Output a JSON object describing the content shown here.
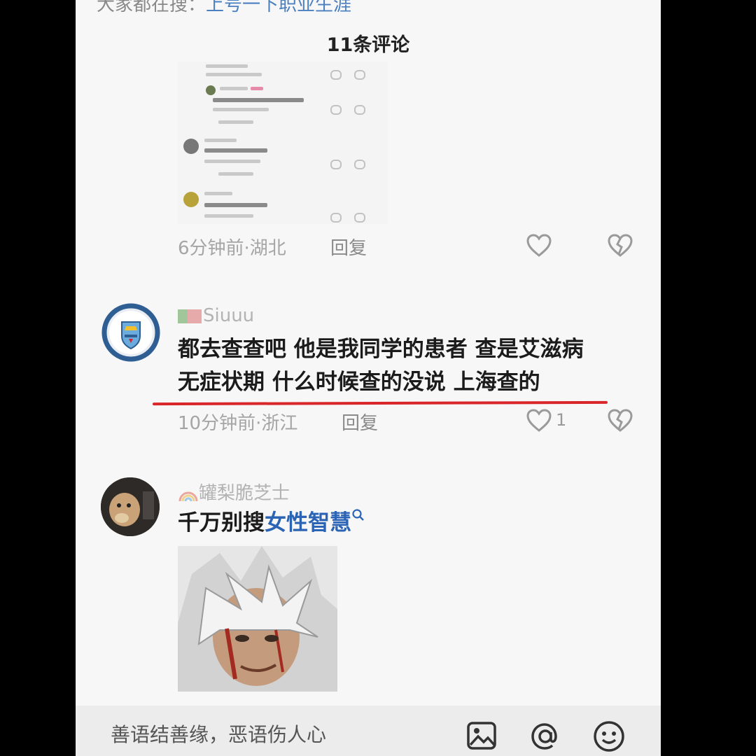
{
  "header": {
    "cut_text": "大家都在搜：",
    "cut_text_blue": "上号一下职业生涯",
    "title": "11条评论"
  },
  "comments": [
    {
      "meta": "6分钟前·湖北",
      "reply": "回复",
      "like_count": ""
    },
    {
      "name": "Siuuu",
      "text_lines": [
        "都去查查吧 他是我同学的患者 查是艾滋病",
        "无症状期 什么时候查的没说 上海查的"
      ],
      "meta": "10分钟前·浙江",
      "reply": "回复",
      "like_count": "1"
    },
    {
      "name": "罐梨脆芝士",
      "text_prefix": "千万别搜",
      "keyword": "女性智慧",
      "meta": ""
    }
  ],
  "input_bar": {
    "placeholder": "善语结善缘，恶语伤人心"
  },
  "colors": {
    "underline": "#d8262a",
    "keyword": "#2c64b5",
    "city_blue": "#6cabdd"
  },
  "icons": [
    "heart-icon",
    "broken-heart-icon",
    "search-icon",
    "image-icon",
    "at-icon",
    "emoji-icon",
    "plus-icon"
  ]
}
